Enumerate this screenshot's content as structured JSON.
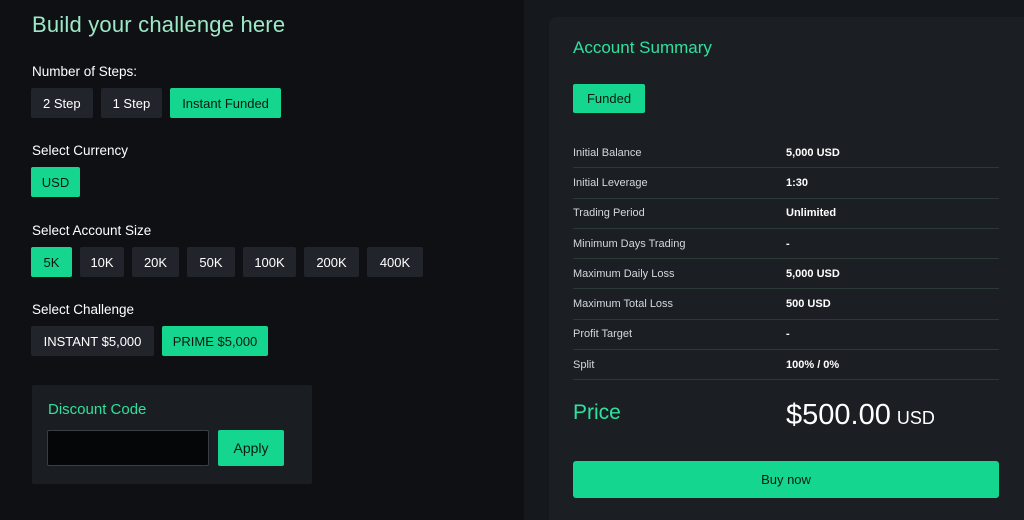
{
  "builder": {
    "title": "Build your challenge here",
    "steps": {
      "label": "Number of Steps:",
      "options": [
        "2 Step",
        "1 Step",
        "Instant Funded"
      ],
      "selected": "Instant Funded"
    },
    "currency": {
      "label": "Select Currency",
      "options": [
        "USD"
      ],
      "selected": "USD"
    },
    "account_size": {
      "label": "Select Account Size",
      "options": [
        "5K",
        "10K",
        "20K",
        "50K",
        "100K",
        "200K",
        "400K"
      ],
      "selected": "5K"
    },
    "challenge": {
      "label": "Select Challenge",
      "options": [
        "INSTANT $5,000",
        "PRIME $5,000"
      ],
      "selected": "PRIME $5,000"
    },
    "discount": {
      "title": "Discount Code",
      "input_value": "",
      "apply_label": "Apply"
    }
  },
  "summary": {
    "title": "Account Summary",
    "badge": "Funded",
    "rows": [
      {
        "label": "Initial Balance",
        "value": "5,000 USD"
      },
      {
        "label": "Initial Leverage",
        "value": "1:30"
      },
      {
        "label": "Trading Period",
        "value": "Unlimited"
      },
      {
        "label": "Minimum Days Trading",
        "value": "-"
      },
      {
        "label": "Maximum Daily Loss",
        "value": "5,000 USD"
      },
      {
        "label": "Maximum Total Loss",
        "value": "500 USD"
      },
      {
        "label": "Profit Target",
        "value": "-"
      },
      {
        "label": "Split",
        "value": "100% / 0%"
      }
    ],
    "price_label": "Price",
    "price_amount": "$500.00",
    "price_currency": "USD",
    "buy_label": "Buy now"
  },
  "colors": {
    "accent": "#15d68e",
    "accent_text": "#2fe19d",
    "background": "#0e1013",
    "card": "#1b1f24"
  }
}
